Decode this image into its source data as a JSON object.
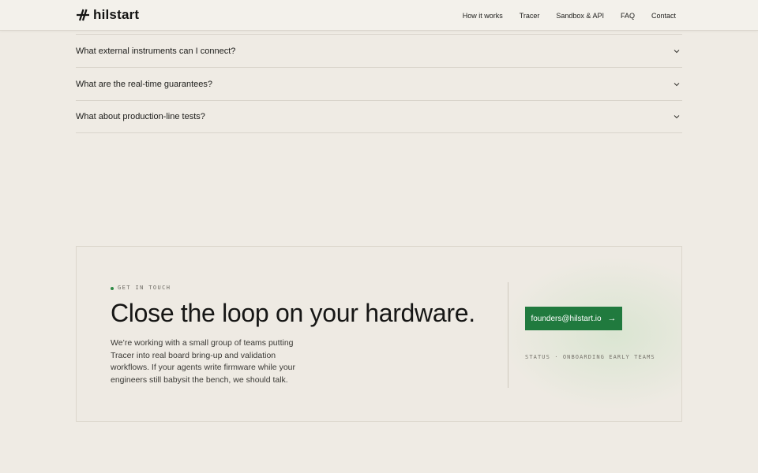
{
  "header": {
    "logo_text": "hilstart",
    "logo_icon": "slash-mark-icon",
    "nav": [
      {
        "label": "How it works"
      },
      {
        "label": "Tracer"
      },
      {
        "label": "Sandbox & API"
      },
      {
        "label": "FAQ"
      },
      {
        "label": "Contact"
      }
    ]
  },
  "faq": {
    "items": [
      {
        "question": "What external instruments can I connect?",
        "icon": "chevron-down-icon"
      },
      {
        "question": "What are the real-time guarantees?",
        "icon": "chevron-down-icon"
      },
      {
        "question": "What about production-line tests?",
        "icon": "chevron-down-icon"
      }
    ]
  },
  "cta": {
    "eyebrow": "GET IN TOUCH",
    "title": "Close the loop on your hardware.",
    "body": "We’re working with a small group of teams putting Tracer into real board bring-up and validation workflows. If your agents write firmware while your engineers still babysit the bench, we should talk.",
    "email_label": "founders@hilstart.io",
    "email_arrow": "→",
    "status": "STATUS · ONBOARDING EARLY TEAMS"
  },
  "colors": {
    "background": "#efebe4",
    "accent_green": "#207a3e",
    "eyebrow_dot": "#2e8a45",
    "text_primary": "#1c1c1a"
  }
}
